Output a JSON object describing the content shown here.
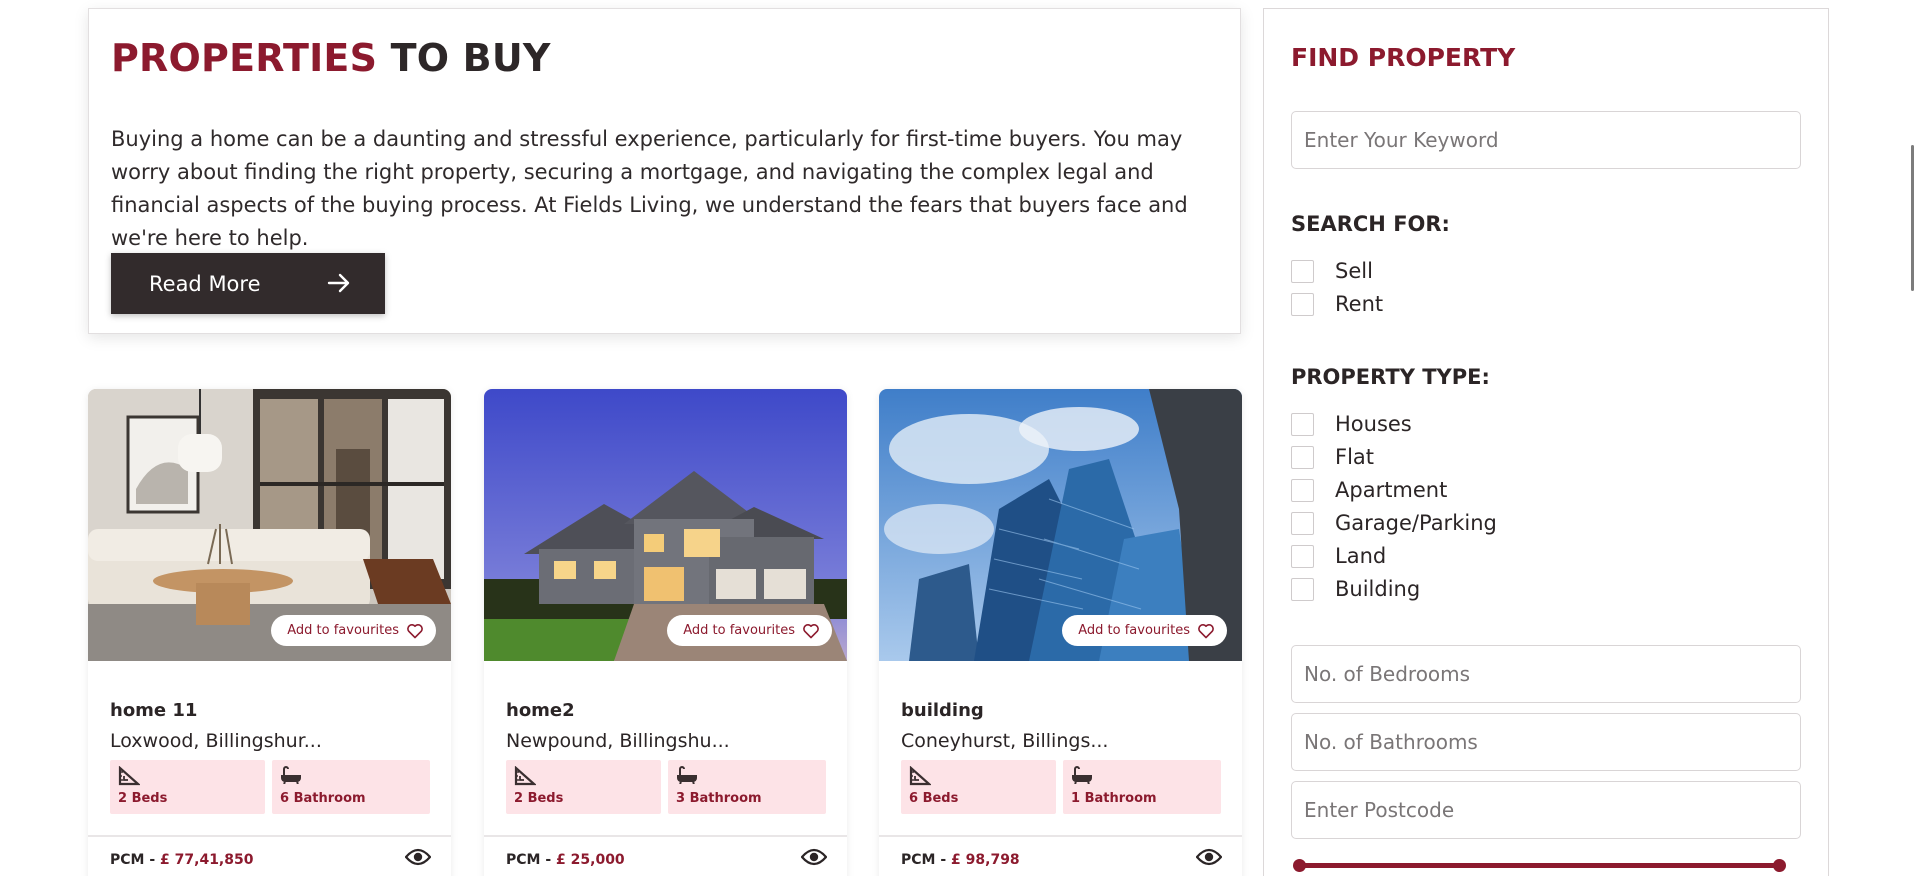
{
  "intro": {
    "title_accent": "PROPERTIES",
    "title_rest": "TO BUY",
    "body": "Buying a home can be a daunting and stressful experience, particularly for first-time buyers. You may worry about finding the right property, securing a mortgage, and navigating the complex legal and financial aspects of the buying process. At Fields Living, we understand the fears that buyers face and we're here to help.",
    "read_more_label": "Read More"
  },
  "properties": [
    {
      "image": "living-room-interior",
      "favourite_label": "Add to favourites",
      "name": "home 11",
      "location": "Loxwood, Billingshur...",
      "beds": "2 Beds",
      "baths": "6 Bathroom",
      "price_prefix": "PCM - ",
      "price": "£ 77,41,850"
    },
    {
      "image": "house-exterior-dusk",
      "favourite_label": "Add to favourites",
      "name": "home2",
      "location": "Newpound, Billingshu...",
      "beds": "2 Beds",
      "baths": "3 Bathroom",
      "price_prefix": "PCM - ",
      "price": "£ 25,000"
    },
    {
      "image": "glass-skyscrapers",
      "favourite_label": "Add to favourites",
      "name": "building",
      "location": "Coneyhurst, Billings...",
      "beds": "6 Beds",
      "baths": "1 Bathroom",
      "price_prefix": "PCM - ",
      "price": "£ 98,798"
    }
  ],
  "sidebar": {
    "title": "FIND PROPERTY",
    "keyword_placeholder": "Enter Your Keyword",
    "search_for_title": "SEARCH FOR:",
    "search_for": [
      "Sell",
      "Rent"
    ],
    "property_type_title": "PROPERTY TYPE:",
    "property_types": [
      "Houses",
      "Flat",
      "Apartment",
      "Garage/Parking",
      "Land",
      "Building"
    ],
    "bedrooms_placeholder": "No. of Bedrooms",
    "bathrooms_placeholder": "No. of Bathrooms",
    "postcode_placeholder": "Enter Postcode"
  },
  "colors": {
    "accent": "#8c1a2e",
    "dark_button": "#322b2c",
    "feature_bg": "#fde3e7"
  }
}
